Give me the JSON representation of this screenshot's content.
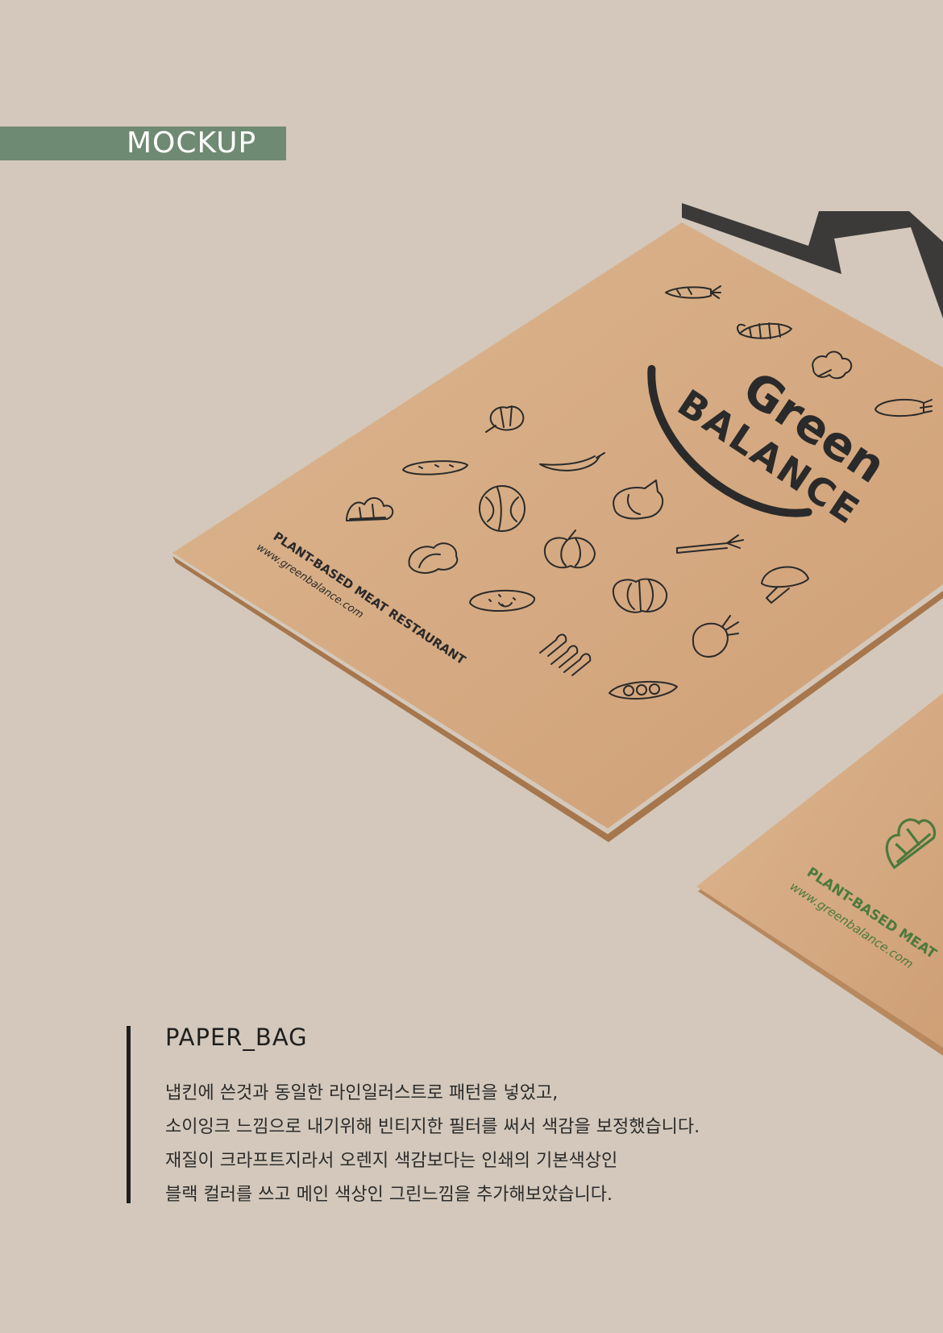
{
  "header": {
    "tag_label": "MOCKUP"
  },
  "bag_front": {
    "brand_top": "Green",
    "brand_bottom": "BALANCE",
    "tagline": "PLANT-BASED MEAT RESTAURANT",
    "website": "www.greenbalance.com",
    "print_color": "#2a2a2a",
    "icons": [
      "carrot-icon",
      "corn-icon",
      "broccoli-icon",
      "eggplant-icon",
      "artichoke-icon",
      "cucumber-icon",
      "chili-icon",
      "spinach-icon",
      "cabbage-icon",
      "garlic-icon",
      "lettuce-icon",
      "pumpkin-icon",
      "leek-icon",
      "potato-icon",
      "squash-icon",
      "mushroom-icon",
      "asparagus-icon",
      "beet-icon",
      "peapod-icon"
    ]
  },
  "bag_back": {
    "tagline": "PLANT-BASED MEAT",
    "website": "www.greenbalance.com",
    "print_color": "#4c7a3c",
    "icons": [
      "spinach-icon"
    ]
  },
  "colors": {
    "background": "#d3c8bb",
    "kraft": "#d6ad86",
    "handle": "#3b3a38",
    "accent_green": "#6f8a72"
  },
  "description": {
    "title": "PAPER_BAG",
    "lines": [
      "냅킨에 쓴것과 동일한 라인일러스트로 패턴을 넣었고,",
      "소이잉크 느낌으로 내기위해 빈티지한 필터를 써서 색감을 보정했습니다.",
      "재질이 크라프트지라서 오렌지 색감보다는 인쇄의 기본색상인",
      "블랙 컬러를 쓰고 메인 색상인 그린느낌을 추가해보았습니다."
    ]
  }
}
